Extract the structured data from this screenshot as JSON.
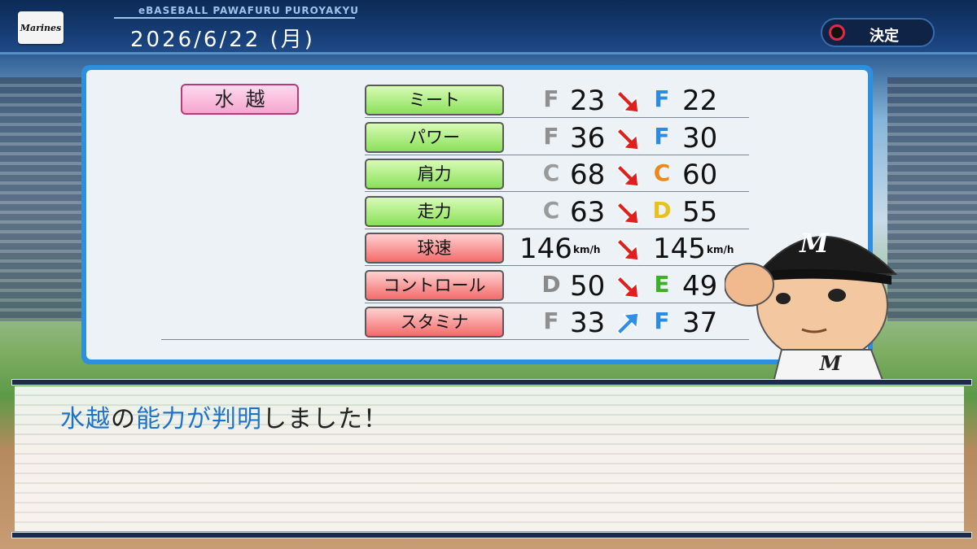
{
  "header": {
    "logo_text": "Marines",
    "game_title": "eBASEBALL PAWAFURU PUROYAKYU",
    "date": "2026/6/22 (月)",
    "confirm_label": "決定"
  },
  "player": {
    "name": "水越"
  },
  "stats": [
    {
      "label": "ミート",
      "type": "batting",
      "before_grade": "F",
      "before_value": "23",
      "after_grade": "F",
      "after_value": "22",
      "change": "down"
    },
    {
      "label": "パワー",
      "type": "batting",
      "before_grade": "F",
      "before_value": "36",
      "after_grade": "F",
      "after_value": "30",
      "change": "down"
    },
    {
      "label": "肩力",
      "type": "batting",
      "before_grade": "C",
      "before_value": "68",
      "after_grade": "C",
      "after_value": "60",
      "change": "down"
    },
    {
      "label": "走力",
      "type": "batting",
      "before_grade": "C",
      "before_value": "63",
      "after_grade": "D",
      "after_value": "55",
      "change": "down"
    },
    {
      "label": "球速",
      "type": "pitching",
      "before_grade": "",
      "before_value": "146",
      "before_unit": "km/h",
      "after_grade": "",
      "after_value": "145",
      "after_unit": "km/h",
      "change": "down"
    },
    {
      "label": "コントロール",
      "type": "pitching",
      "before_grade": "D",
      "before_value": "50",
      "after_grade": "E",
      "after_value": "49",
      "change": "down"
    },
    {
      "label": "スタミナ",
      "type": "pitching",
      "before_grade": "F",
      "before_value": "33",
      "after_grade": "F",
      "after_value": "37",
      "change": "up"
    }
  ],
  "grade_colors": {
    "F": "#8f8f8f",
    "F_after": "#2a8be0",
    "C": "#9a9a9a",
    "C_after": "#e98a1a",
    "D": "#8a8a8a",
    "D_after": "#e6c21e",
    "E_after": "#3fae2a"
  },
  "message": {
    "part1": "水越",
    "part2": "の",
    "part3": "能力が判明",
    "part4": "しました！"
  }
}
